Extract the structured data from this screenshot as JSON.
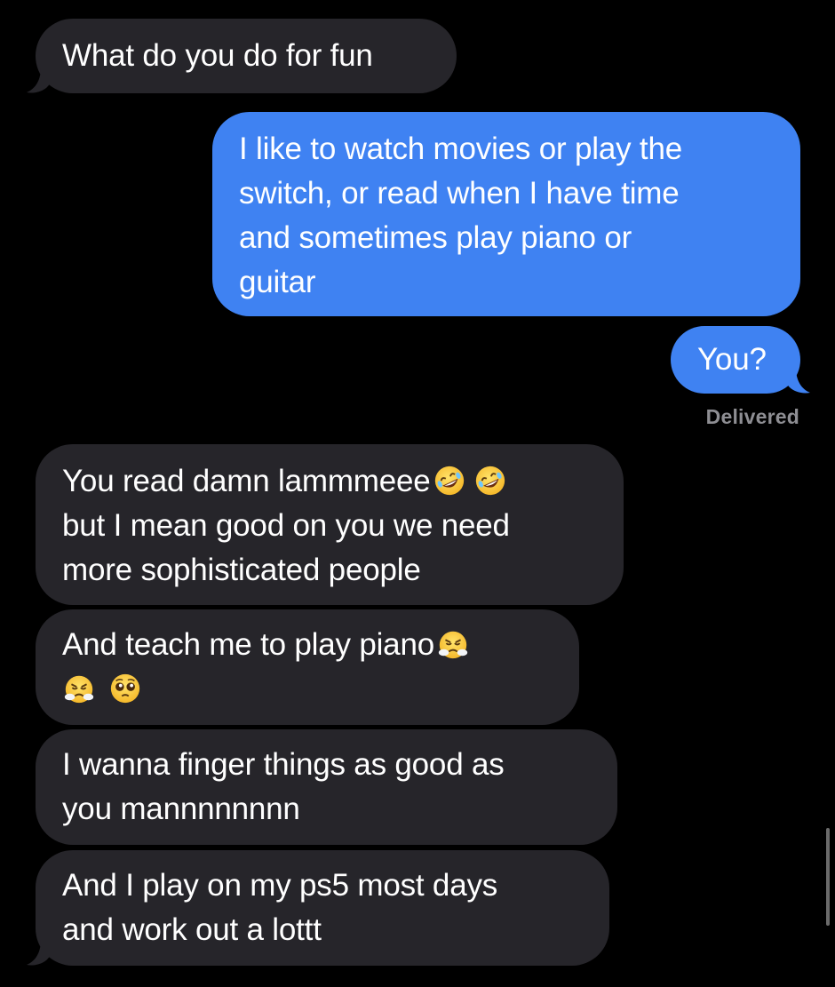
{
  "messages": [
    {
      "id": "m1",
      "direction": "incoming",
      "lines": [
        "What do you do for fun"
      ]
    },
    {
      "id": "m2",
      "direction": "outgoing",
      "lines": [
        "I like to watch movies or play the",
        "switch, or read when I have time",
        "and sometimes play piano or",
        "guitar"
      ]
    },
    {
      "id": "m3",
      "direction": "outgoing",
      "lines": [
        "You?"
      ]
    },
    {
      "id": "m4",
      "direction": "incoming",
      "lines": [
        "You read damn lammmeee",
        "but I mean good on you we need",
        "more sophisticated people"
      ]
    },
    {
      "id": "m5",
      "direction": "incoming",
      "lines": [
        "And teach me to play piano",
        ""
      ]
    },
    {
      "id": "m6",
      "direction": "incoming",
      "lines": [
        "I wanna finger things as good as",
        "you mannnnnnnn"
      ]
    },
    {
      "id": "m7",
      "direction": "incoming",
      "lines": [
        "And I play on my ps5 most days",
        "and work out a lottt"
      ]
    }
  ],
  "status": {
    "delivered": "Delivered"
  },
  "emojis": {
    "m4_line0": [
      "rolling-on-floor-laughing",
      "rolling-on-floor-laughing"
    ],
    "m5_line0": [
      "face-with-steam-from-nose"
    ],
    "m5_line1": [
      "face-with-steam-from-nose",
      "pleading-face"
    ]
  },
  "colors": {
    "background": "#000000",
    "incoming_bubble": "#26252a",
    "outgoing_bubble": "#3f82f2",
    "status_text": "#8e8e93"
  }
}
